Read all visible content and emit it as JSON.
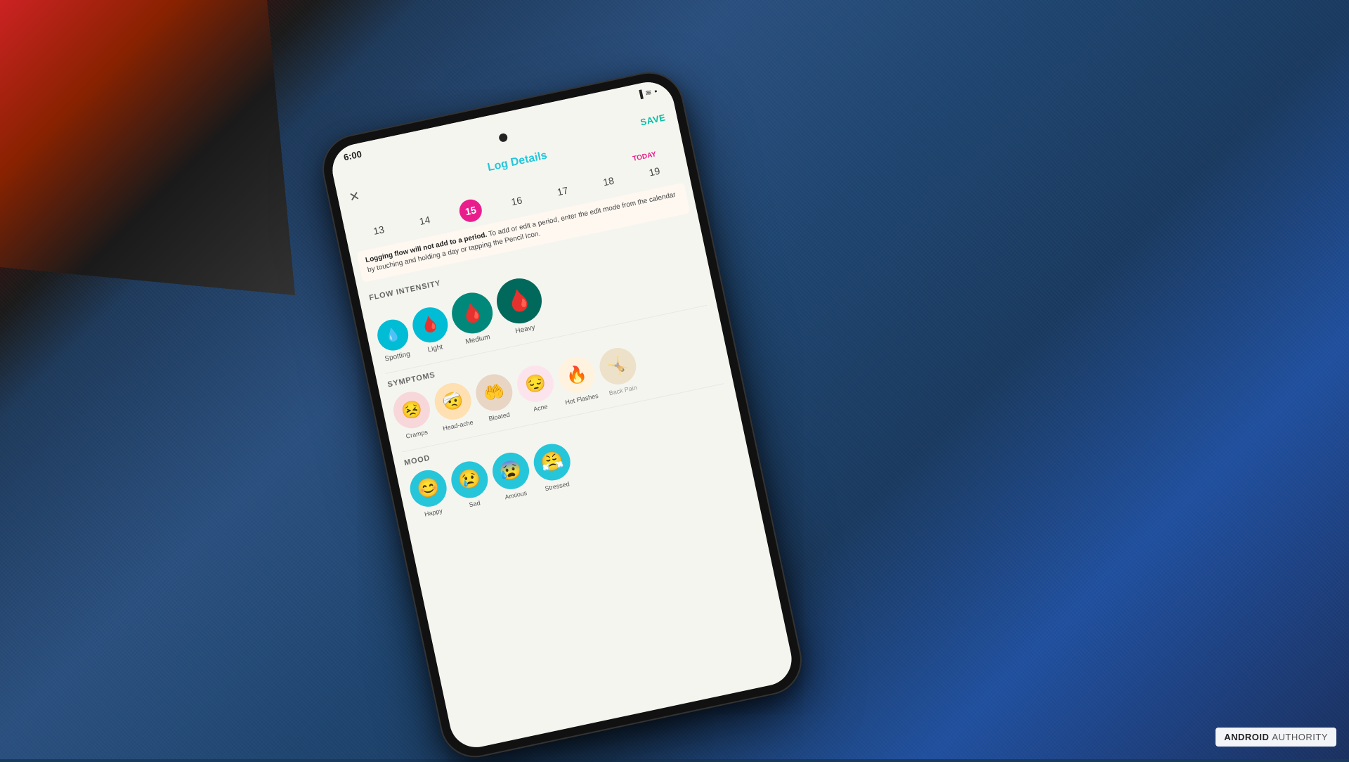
{
  "background": {
    "description": "Blue fabric sofa/chair with window in top-left corner"
  },
  "watermark": {
    "android": "ANDROID",
    "authority": "AUTHORITY"
  },
  "phone": {
    "status_bar": {
      "time": "6:00",
      "icons": "📶 📡 🔋"
    },
    "header": {
      "save_label": "SAVE",
      "title": "Log Details",
      "close_icon": "✕"
    },
    "calendar": {
      "today_label": "TODAY",
      "days": [
        {
          "num": "13",
          "today": false
        },
        {
          "num": "14",
          "today": false
        },
        {
          "num": "15",
          "today": true
        },
        {
          "num": "16",
          "today": false
        },
        {
          "num": "17",
          "today": false
        },
        {
          "num": "18",
          "today": false
        },
        {
          "num": "19",
          "today": false
        }
      ]
    },
    "info_banner": {
      "bold": "Logging flow will not add to a period.",
      "normal": " To add or edit a period, enter the edit mode from the calendar by touching and holding a day or tapping the Pencil Icon."
    },
    "flow_section": {
      "title": "FLOW INTENSITY",
      "items": [
        {
          "label": "Spotting",
          "size": "small",
          "emoji": "💧"
        },
        {
          "label": "Light",
          "size": "medium-size",
          "emoji": "💧"
        },
        {
          "label": "Medium",
          "size": "large",
          "emoji": "🩸"
        },
        {
          "label": "Heavy",
          "size": "xlarge",
          "emoji": "🩸"
        }
      ]
    },
    "symptoms_section": {
      "title": "SYMPTOMS",
      "items": [
        {
          "label": "Cramps",
          "emoji": "😣"
        },
        {
          "label": "Head-ache",
          "emoji": "🤕"
        },
        {
          "label": "Bloated",
          "emoji": "🤲"
        },
        {
          "label": "Acne",
          "emoji": "😔"
        },
        {
          "label": "Hot Flashes",
          "emoji": "🔥"
        },
        {
          "label": "Back Pain",
          "emoji": "🤸"
        }
      ]
    },
    "mood_section": {
      "title": "MOOD",
      "items": [
        {
          "label": "Happy",
          "emoji": "😊"
        },
        {
          "label": "Sad",
          "emoji": "😢"
        },
        {
          "label": "Anxious",
          "emoji": "😰"
        },
        {
          "label": "Stressed",
          "emoji": "😤"
        }
      ]
    }
  }
}
